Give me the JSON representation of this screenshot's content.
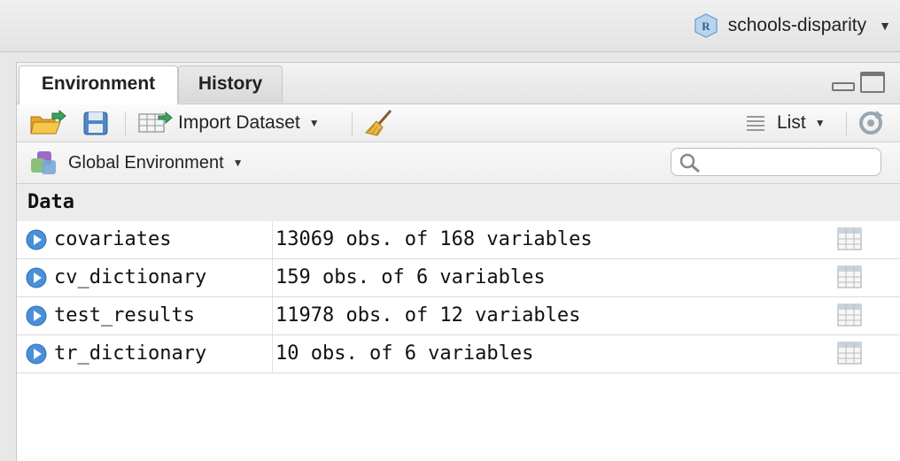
{
  "project": {
    "name": "schools-disparity",
    "icon": "r-project-icon"
  },
  "tabs": [
    {
      "label": "Environment",
      "active": true
    },
    {
      "label": "History",
      "active": false
    }
  ],
  "toolbar": {
    "import_label": "Import Dataset",
    "view_label": "List"
  },
  "env": {
    "selector_label": "Global Environment",
    "search_placeholder": ""
  },
  "section_title": "Data",
  "rows": [
    {
      "name": "covariates",
      "desc": "13069 obs. of 168 variables"
    },
    {
      "name": "cv_dictionary",
      "desc": "159 obs. of 6 variables"
    },
    {
      "name": "test_results",
      "desc": "11978 obs. of 12 variables"
    },
    {
      "name": "tr_dictionary",
      "desc": "10 obs. of 6 variables"
    }
  ],
  "colors": {
    "accent_blue": "#4a90d9",
    "folder": "#f0b429",
    "arrow": "#3aa35b"
  }
}
